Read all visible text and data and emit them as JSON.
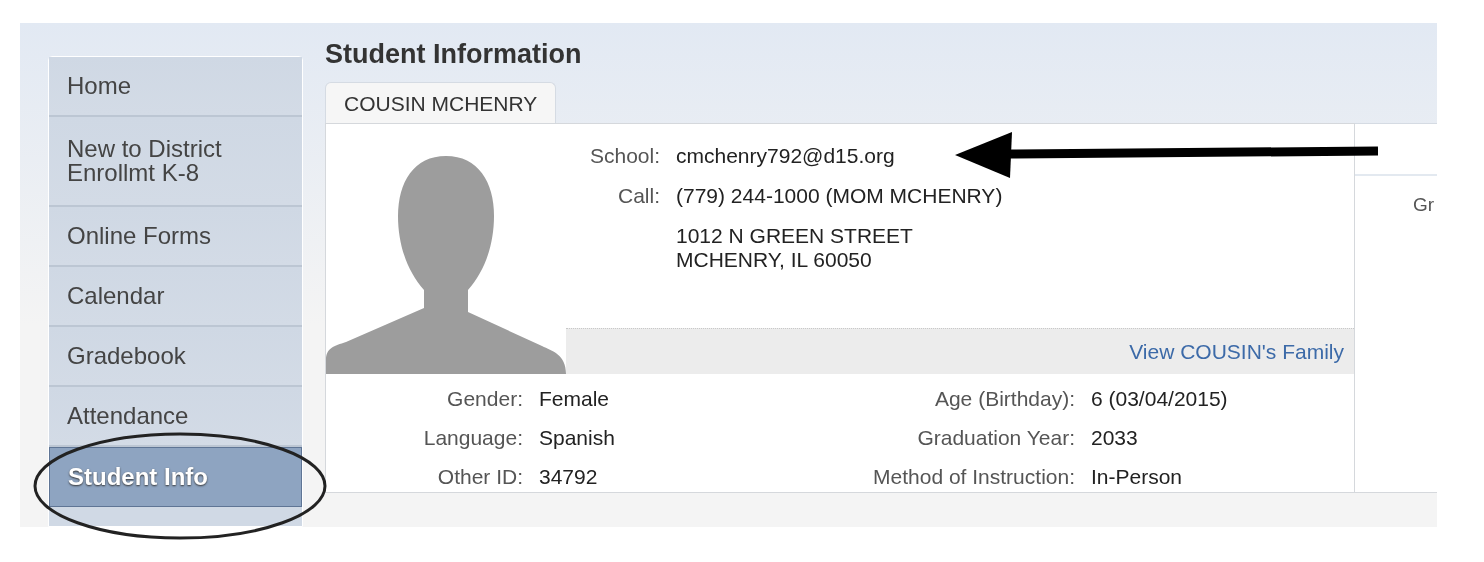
{
  "page": {
    "title": "Student Information"
  },
  "sidebar": {
    "items": [
      {
        "label": "Home",
        "selected": false
      },
      {
        "label": "New to District\nEnrollmt K-8",
        "selected": false
      },
      {
        "label": "Online Forms",
        "selected": false
      },
      {
        "label": "Calendar",
        "selected": false
      },
      {
        "label": "Gradebook",
        "selected": false
      },
      {
        "label": "Attendance",
        "selected": false
      },
      {
        "label": "Student Info",
        "selected": true
      }
    ]
  },
  "tabs": [
    {
      "label": "COUSIN MCHENRY",
      "selected": true
    }
  ],
  "contact": [
    {
      "label": "School:",
      "value": "cmchenry792@d15.org"
    },
    {
      "label": "Call:",
      "value": "(779) 244-1000 (MOM MCHENRY)"
    },
    {
      "value": "1012 N GREEN STREET\nMCHENRY, IL 60050"
    }
  ],
  "family_link": "View COUSIN's Family",
  "details": {
    "left": [
      {
        "label": "Gender:",
        "value": "Female"
      },
      {
        "label": "Language:",
        "value": "Spanish"
      },
      {
        "label": "Other ID:",
        "value": "34792"
      }
    ],
    "right": [
      {
        "label": "Age (Birthday):",
        "value": "6 (03/04/2015)"
      },
      {
        "label": "Graduation Year:",
        "value": "2033"
      },
      {
        "label": "Method of Instruction:",
        "value": "In-Person"
      }
    ]
  },
  "side_panel": {
    "column_1": "Gr"
  }
}
